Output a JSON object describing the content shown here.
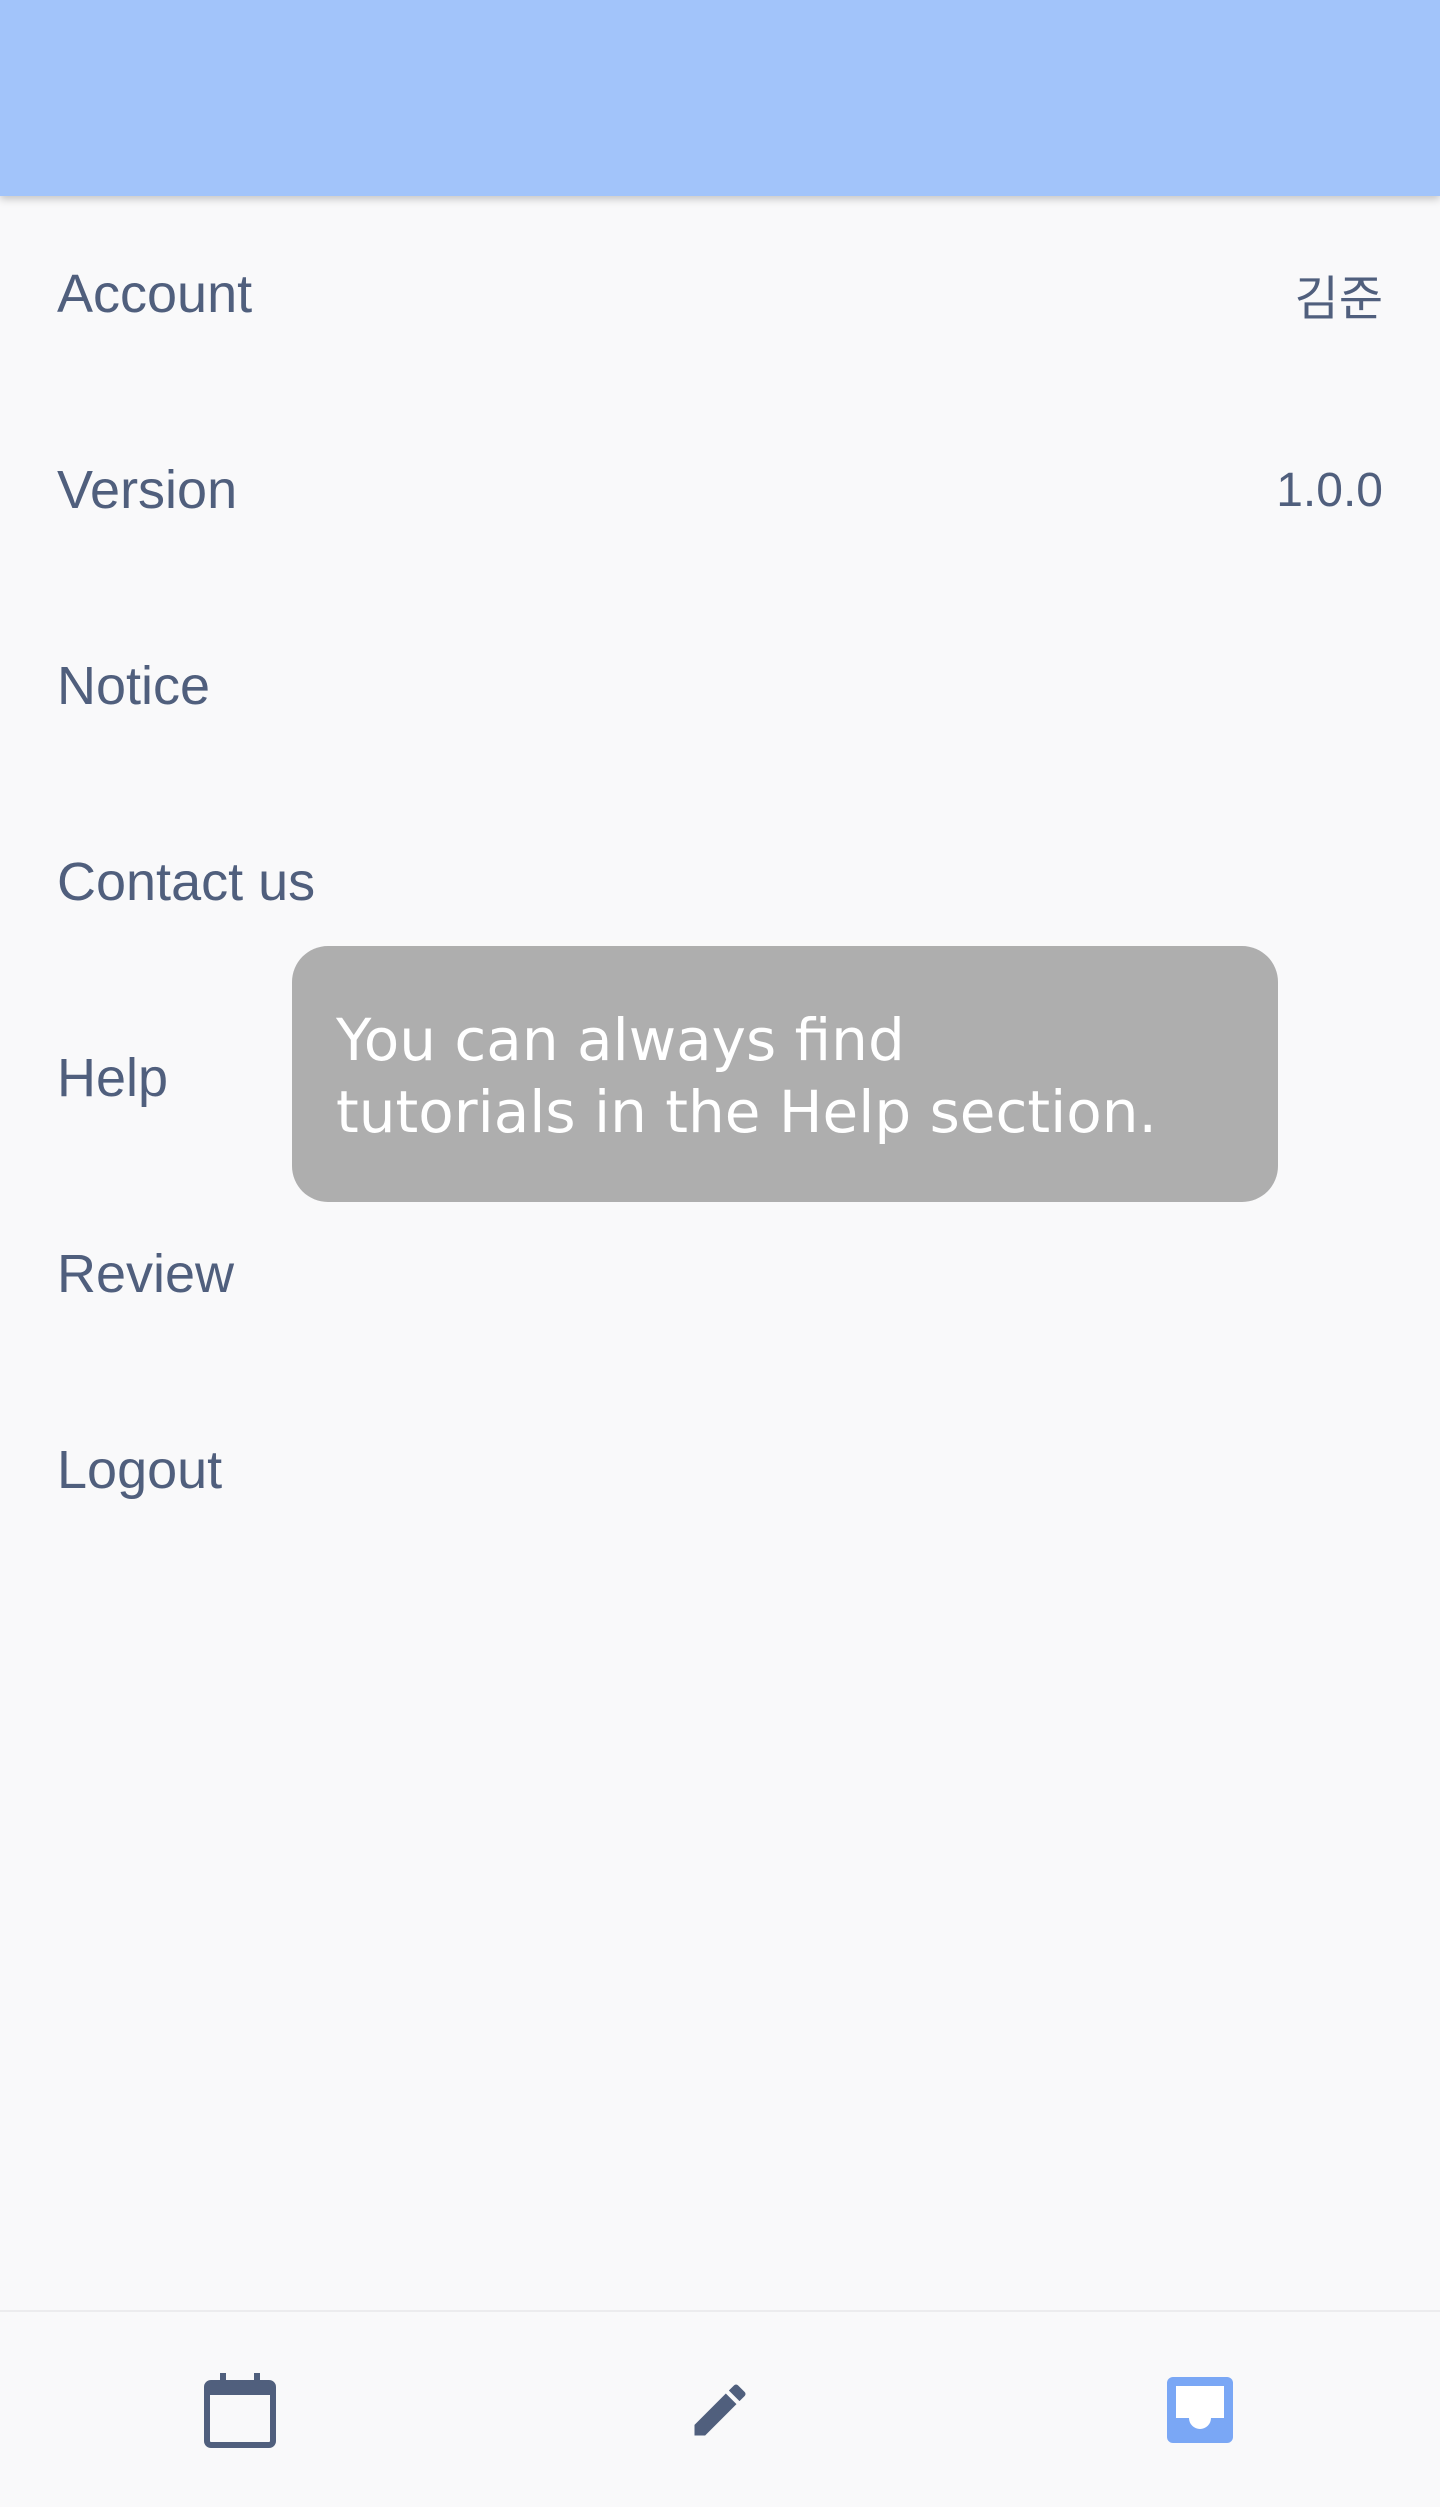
{
  "settings": {
    "items": [
      {
        "label": "Account",
        "value": "김준"
      },
      {
        "label": "Version",
        "value": "1.0.0"
      },
      {
        "label": "Notice",
        "value": ""
      },
      {
        "label": "Contact us",
        "value": ""
      },
      {
        "label": "Help",
        "value": ""
      },
      {
        "label": "Review",
        "value": ""
      },
      {
        "label": "Logout",
        "value": ""
      }
    ]
  },
  "tooltip": {
    "text": "You can always find\ntutorials in the Help section."
  },
  "bottom_nav": {
    "items": [
      {
        "icon": "calendar-icon",
        "active": false
      },
      {
        "icon": "pencil-icon",
        "active": false
      },
      {
        "icon": "inbox-icon",
        "active": true
      }
    ]
  },
  "colors": {
    "app_bar": "#a2c4fa",
    "text": "#505f7d",
    "accent": "#7aa7f5",
    "tooltip_bg": "#aeaeae"
  }
}
